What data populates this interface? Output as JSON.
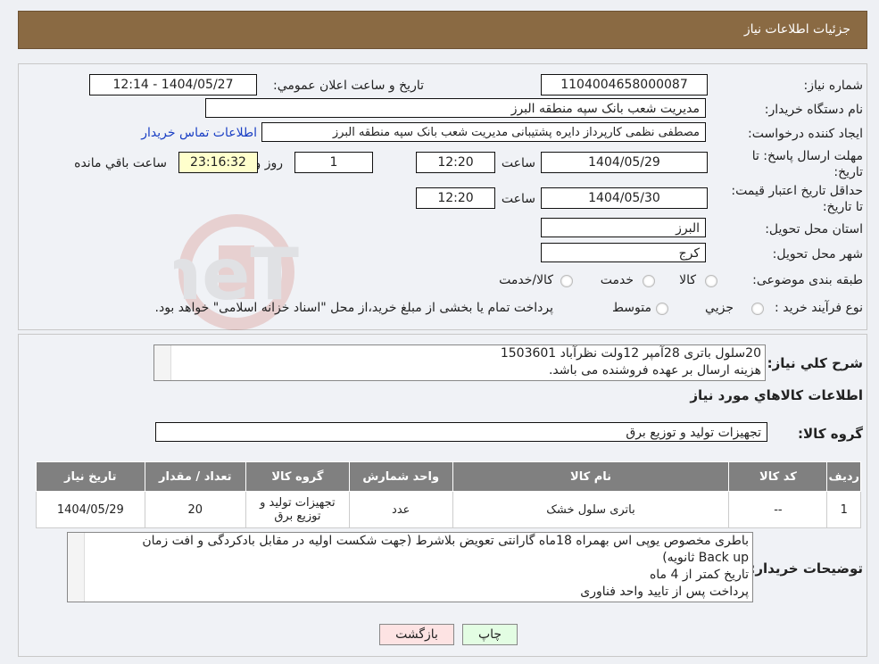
{
  "header": {
    "title": "جزئیات اطلاعات نیاز"
  },
  "form": {
    "need_number_label": "شماره نیاز:",
    "need_number": "1104004658000087",
    "announce_label": "تاریخ و ساعت اعلان عمومي:",
    "announce_value": "1404/05/27 - 12:14",
    "buyer_org_label": "نام دستگاه خریدار:",
    "buyer_org": "مدیریت شعب بانک سپه منطقه البرز",
    "creator_label": "ایجاد کننده درخواست:",
    "creator": "مصطفی نظمی کارپرداز دایره پشتیبانی مدیریت شعب بانک سپه منطقه البرز",
    "contact_link": "اطلاعات تماس خریدار",
    "reply_deadline_label": "مهلت ارسال پاسخ: تا تاریخ:",
    "reply_date": "1404/05/29",
    "time_label": "ساعت",
    "reply_time": "12:20",
    "days": "1",
    "days_label": "روز و",
    "remaining": "23:16:32",
    "remaining_label": "ساعت باقي مانده",
    "price_validity_label": "حداقل تاریخ اعتبار قیمت: تا تاریخ:",
    "price_date": "1404/05/30",
    "price_time": "12:20",
    "province_label": "استان محل تحویل:",
    "province": "البرز",
    "city_label": "شهر محل تحویل:",
    "city": "کرج",
    "category_label": "طبقه بندی موضوعی:",
    "category_options": [
      "کالا",
      "خدمت",
      "کالا/خدمت"
    ],
    "process_label": "نوع فرآیند خرید :",
    "process_options": [
      "جزیي",
      "متوسط"
    ],
    "process_note": "پرداخت تمام یا بخشی از مبلغ خرید،از محل \"اسناد خزانه اسلامی\" خواهد بود."
  },
  "watermark": {
    "text": "AriaTender.neT"
  },
  "summary": {
    "label": "شرح کلي نیاز:",
    "line1": "20سلول باتری 28آمپر 12ولت نظرآباد 1503601",
    "line2": "هزینه ارسال بر عهده فروشنده می باشد."
  },
  "goods": {
    "section_title": "اطلاعات کالاهاي مورد نیاز",
    "group_label": "گروه کالا:",
    "group_value": "تجهیزات تولید و توزیع برق",
    "columns": [
      "ردیف",
      "کد کالا",
      "نام کالا",
      "واحد شمارش",
      "گروه کالا",
      "تعداد / مقدار",
      "تاریخ نیاز"
    ],
    "rows": [
      [
        "1",
        "--",
        "باتری سلول خشک",
        "عدد",
        "تجهیزات تولید و توزیع برق",
        "20",
        "1404/05/29"
      ]
    ]
  },
  "buyer_notes": {
    "label": "توضیحات خریدار:",
    "line1": "باطری مخصوص یوپی اس بهمراه 18ماه گارانتی تعویض بلاشرط (جهت شکست اولیه در مقابل بادکردگی و افت زمان",
    "line2": "Back up ثانویه)",
    "line3": "تاریخ کمتر از 4 ماه",
    "line4": "پرداخت پس از تایید واحد فناوری"
  },
  "buttons": {
    "print": "چاپ",
    "back": "بازگشت"
  },
  "colors": {
    "header_bg": "#8a6a43",
    "table_header_bg": "#808080",
    "link": "#1a3fc4",
    "back_btn": "#fde3e3",
    "print_btn": "#e3fde3"
  }
}
